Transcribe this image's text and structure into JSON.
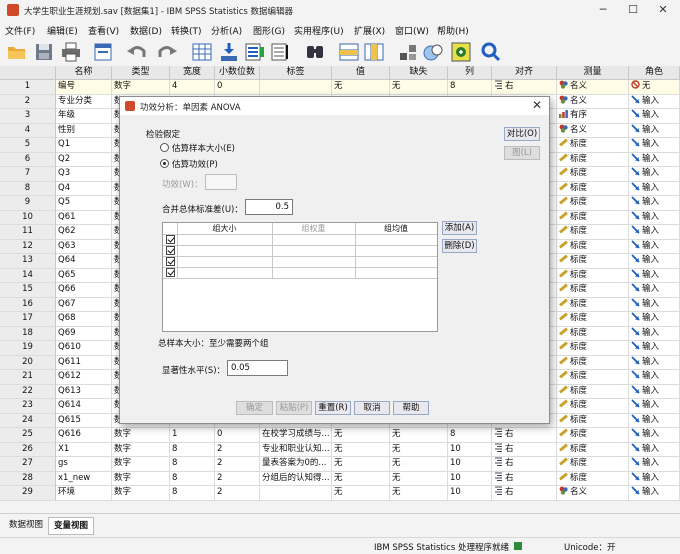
{
  "window": {
    "title": "大学生职业生涯规划.sav [数据集1] - IBM SPSS Statistics 数据编辑器",
    "minimize": "─",
    "maximize": "☐",
    "close": "✕"
  },
  "menu": [
    "文件(F)",
    "编辑(E)",
    "查看(V)",
    "数据(D)",
    "转换(T)",
    "分析(A)",
    "图形(G)",
    "实用程序(U)",
    "扩展(X)",
    "窗口(W)",
    "帮助(H)"
  ],
  "toolbar": [
    "open-folder-icon",
    "save-icon",
    "print-icon",
    "dialog-recall-icon",
    "undo-icon",
    "redo-icon",
    "goto-case-icon",
    "goto-variable-icon",
    "variables-icon",
    "run-descriptives-icon",
    "find-icon",
    "insert-cases-icon",
    "insert-variable-icon",
    "split-file-icon",
    "value-labels-icon",
    "use-sets-icon",
    "search-icon"
  ],
  "columns": [
    "名称",
    "类型",
    "宽度",
    "小数位数",
    "标签",
    "值",
    "缺失",
    "列",
    "对齐",
    "测量",
    "角色"
  ],
  "rows": [
    {
      "n": "1",
      "name": "编号",
      "type": "数字",
      "width": "4",
      "dec": "0",
      "label": "",
      "values": "无",
      "missing": "无",
      "cols": "8",
      "align": "右",
      "measure": "名义",
      "role": "无"
    },
    {
      "n": "2",
      "name": "专业分类",
      "type": "数",
      "width": "",
      "dec": "",
      "label": "",
      "values": "",
      "missing": "",
      "cols": "",
      "align": "",
      "measure": "名义",
      "role": "输入"
    },
    {
      "n": "3",
      "name": "年级",
      "type": "数",
      "width": "",
      "dec": "",
      "label": "",
      "values": "",
      "missing": "",
      "cols": "",
      "align": "",
      "measure": "有序",
      "role": "输入"
    },
    {
      "n": "4",
      "name": "性别",
      "type": "数",
      "width": "",
      "dec": "",
      "label": "",
      "values": "",
      "missing": "",
      "cols": "",
      "align": "",
      "measure": "名义",
      "role": "输入"
    },
    {
      "n": "5",
      "name": "Q1",
      "type": "数",
      "width": "",
      "dec": "",
      "label": "",
      "values": "",
      "missing": "",
      "cols": "",
      "align": "",
      "measure": "标度",
      "role": "输入"
    },
    {
      "n": "6",
      "name": "Q2",
      "type": "数",
      "width": "",
      "dec": "",
      "label": "",
      "values": "",
      "missing": "",
      "cols": "",
      "align": "",
      "measure": "标度",
      "role": "输入"
    },
    {
      "n": "7",
      "name": "Q3",
      "type": "数",
      "width": "",
      "dec": "",
      "label": "",
      "values": "",
      "missing": "",
      "cols": "",
      "align": "",
      "measure": "标度",
      "role": "输入"
    },
    {
      "n": "8",
      "name": "Q4",
      "type": "数",
      "width": "",
      "dec": "",
      "label": "",
      "values": "",
      "missing": "",
      "cols": "",
      "align": "",
      "measure": "标度",
      "role": "输入"
    },
    {
      "n": "9",
      "name": "Q5",
      "type": "数",
      "width": "",
      "dec": "",
      "label": "",
      "values": "",
      "missing": "",
      "cols": "",
      "align": "",
      "measure": "标度",
      "role": "输入"
    },
    {
      "n": "10",
      "name": "Q61",
      "type": "数",
      "width": "",
      "dec": "",
      "label": "",
      "values": "",
      "missing": "",
      "cols": "",
      "align": "",
      "measure": "标度",
      "role": "输入"
    },
    {
      "n": "11",
      "name": "Q62",
      "type": "数",
      "width": "",
      "dec": "",
      "label": "",
      "values": "",
      "missing": "",
      "cols": "",
      "align": "",
      "measure": "标度",
      "role": "输入"
    },
    {
      "n": "12",
      "name": "Q63",
      "type": "数",
      "width": "",
      "dec": "",
      "label": "",
      "values": "",
      "missing": "",
      "cols": "",
      "align": "",
      "measure": "标度",
      "role": "输入"
    },
    {
      "n": "13",
      "name": "Q64",
      "type": "数",
      "width": "",
      "dec": "",
      "label": "",
      "values": "",
      "missing": "",
      "cols": "",
      "align": "",
      "measure": "标度",
      "role": "输入"
    },
    {
      "n": "14",
      "name": "Q65",
      "type": "数",
      "width": "",
      "dec": "",
      "label": "",
      "values": "",
      "missing": "",
      "cols": "",
      "align": "",
      "measure": "标度",
      "role": "输入"
    },
    {
      "n": "15",
      "name": "Q66",
      "type": "数",
      "width": "",
      "dec": "",
      "label": "",
      "values": "",
      "missing": "",
      "cols": "",
      "align": "",
      "measure": "标度",
      "role": "输入"
    },
    {
      "n": "16",
      "name": "Q67",
      "type": "数",
      "width": "",
      "dec": "",
      "label": "",
      "values": "",
      "missing": "",
      "cols": "",
      "align": "",
      "measure": "标度",
      "role": "输入"
    },
    {
      "n": "17",
      "name": "Q68",
      "type": "数",
      "width": "",
      "dec": "",
      "label": "",
      "values": "",
      "missing": "",
      "cols": "",
      "align": "",
      "measure": "标度",
      "role": "输入"
    },
    {
      "n": "18",
      "name": "Q69",
      "type": "数",
      "width": "",
      "dec": "",
      "label": "",
      "values": "",
      "missing": "",
      "cols": "",
      "align": "",
      "measure": "标度",
      "role": "输入"
    },
    {
      "n": "19",
      "name": "Q610",
      "type": "数",
      "width": "",
      "dec": "",
      "label": "",
      "values": "",
      "missing": "",
      "cols": "",
      "align": "",
      "measure": "标度",
      "role": "输入"
    },
    {
      "n": "20",
      "name": "Q611",
      "type": "数",
      "width": "",
      "dec": "",
      "label": "",
      "values": "",
      "missing": "",
      "cols": "",
      "align": "",
      "measure": "标度",
      "role": "输入"
    },
    {
      "n": "21",
      "name": "Q612",
      "type": "数",
      "width": "",
      "dec": "",
      "label": "",
      "values": "",
      "missing": "",
      "cols": "",
      "align": "",
      "measure": "标度",
      "role": "输入"
    },
    {
      "n": "22",
      "name": "Q613",
      "type": "数",
      "width": "",
      "dec": "",
      "label": "",
      "values": "",
      "missing": "",
      "cols": "",
      "align": "",
      "measure": "标度",
      "role": "输入"
    },
    {
      "n": "23",
      "name": "Q614",
      "type": "数",
      "width": "",
      "dec": "",
      "label": "",
      "values": "",
      "missing": "",
      "cols": "",
      "align": "",
      "measure": "标度",
      "role": "输入"
    },
    {
      "n": "24",
      "name": "Q615",
      "type": "数",
      "width": "",
      "dec": "",
      "label": "",
      "values": "",
      "missing": "",
      "cols": "",
      "align": "",
      "measure": "标度",
      "role": "输入"
    },
    {
      "n": "25",
      "name": "Q616",
      "type": "数字",
      "width": "1",
      "dec": "0",
      "label": "在校学习成绩与...",
      "values": "无",
      "missing": "无",
      "cols": "8",
      "align": "右",
      "measure": "标度",
      "role": "输入"
    },
    {
      "n": "26",
      "name": "X1",
      "type": "数字",
      "width": "8",
      "dec": "2",
      "label": "专业和职业认知...",
      "values": "无",
      "missing": "无",
      "cols": "10",
      "align": "右",
      "measure": "标度",
      "role": "输入"
    },
    {
      "n": "27",
      "name": "gs",
      "type": "数字",
      "width": "8",
      "dec": "2",
      "label": "量表答案为0的...",
      "values": "无",
      "missing": "无",
      "cols": "10",
      "align": "右",
      "measure": "标度",
      "role": "输入"
    },
    {
      "n": "28",
      "name": "x1_new",
      "type": "数字",
      "width": "8",
      "dec": "2",
      "label": "分组后的认知得...",
      "values": "无",
      "missing": "无",
      "cols": "10",
      "align": "右",
      "measure": "标度",
      "role": "输入"
    },
    {
      "n": "29",
      "name": "环境",
      "type": "数字",
      "width": "8",
      "dec": "2",
      "label": "",
      "values": "无",
      "missing": "无",
      "cols": "10",
      "align": "右",
      "measure": "名义",
      "role": "输入"
    }
  ],
  "tabs": {
    "data_view": "数据视图",
    "variable_view": "变量视图"
  },
  "status": {
    "processor": "IBM SPSS Statistics 处理程序就绪",
    "unicode": "Unicode：开"
  },
  "dialog": {
    "title": "功效分析：单因素 ANOVA",
    "section": "检验假定",
    "radio_sample": "估算样本大小(E)",
    "radio_power": "估算功效(P)",
    "power_label": "功效(W)：",
    "power_value": "",
    "pooled_sd_label": "合并总体标准差(U)：",
    "pooled_sd_value": "0.5",
    "table_headers": [
      "组大小",
      "组权重",
      "组均值"
    ],
    "add_btn": "添加(A)",
    "delete_btn": "删除(D)",
    "note": "总样本大小：至少需要两个组",
    "alpha_label": "显著性水平(S)：",
    "alpha_value": "0.05",
    "contrast_btn": "对比(O)",
    "plot_btn": "图(L)",
    "ok_btn": "确定",
    "paste_btn": "粘贴(P)",
    "reset_btn": "重置(R)",
    "cancel_btn": "取消",
    "help_btn": "帮助"
  },
  "colors": {
    "measure_scale": "#c9a227",
    "role_input": "#1f5fbf",
    "measure_nominal": "#c0392b",
    "measure_ordinal": "#6a8f3a"
  }
}
